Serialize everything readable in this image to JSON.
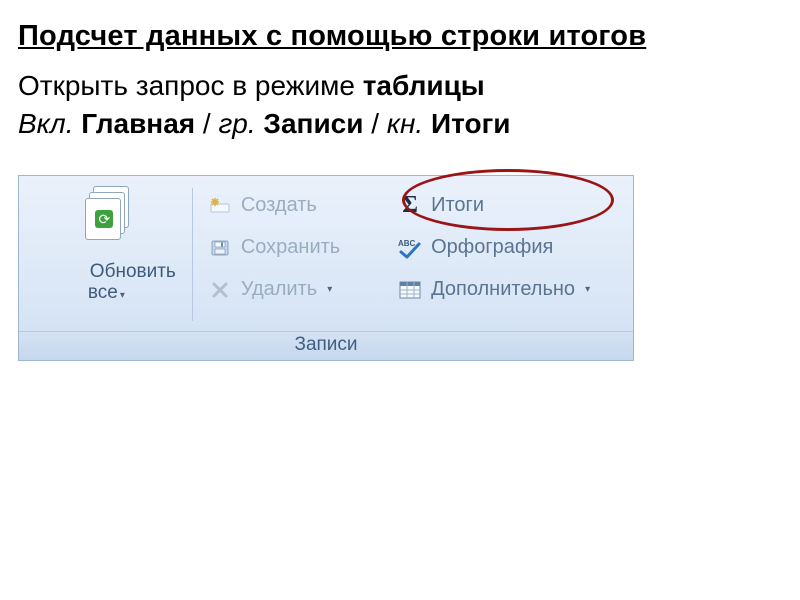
{
  "title": "Подсчет данных с помощью строки итогов",
  "line1": {
    "prefix": "Открыть запрос в режиме ",
    "bold": "таблицы"
  },
  "line2": {
    "p1": "Вкл.",
    "p2": "Главная",
    "s1": " / ",
    "p3": "гр.",
    "p4": "Записи",
    "s2": " / ",
    "p5": "кн.",
    "p6": "Итоги"
  },
  "ribbon": {
    "refresh": "Обновить\nвсе",
    "new": "Создать",
    "save": "Сохранить",
    "delete": "Удалить",
    "totals": "Итоги",
    "spelling": "Орфография",
    "more": "Дополнительно",
    "group": "Записи"
  }
}
